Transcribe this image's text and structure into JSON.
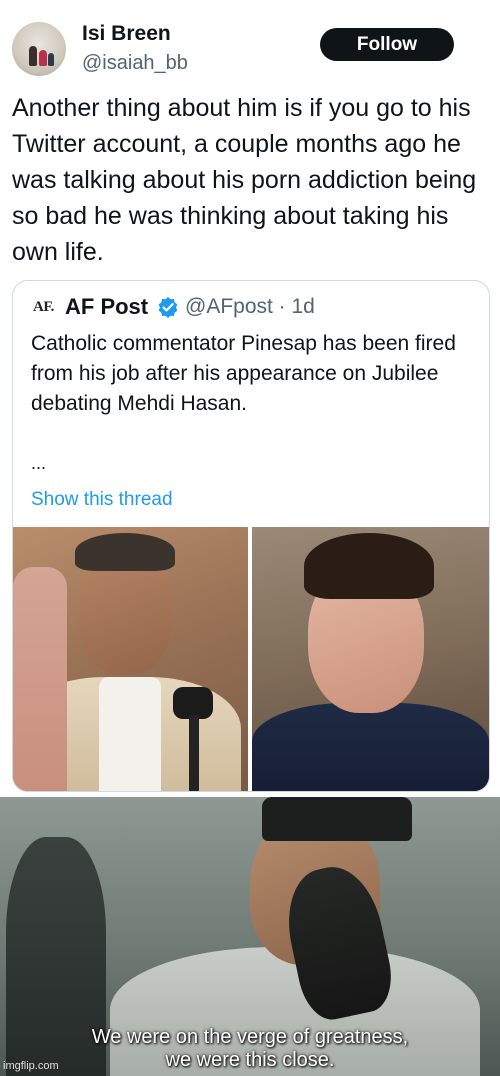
{
  "tweet": {
    "display_name": "Isi Breen",
    "handle": "@isaiah_bb",
    "follow_label": "Follow",
    "text": "Another thing about him is if you go to his Twitter account, a couple months ago he was talking about his porn addiction being so bad he was thinking about taking his own life."
  },
  "quote": {
    "logo_text": "AF.",
    "name": "AF Post",
    "meta": "@AFpost · 1d",
    "text": "Catholic commentator Pinesap has been fired from his job after his appearance on Jubilee debating Mehdi Hasan.",
    "ellipsis": "...",
    "show_thread": "Show this thread",
    "verified_color": "#1d9bf0",
    "link_color": "#1d9bf0"
  },
  "meme": {
    "caption_line1": "We were on the verge of greatness,",
    "caption_line2": "we were this close.",
    "watermark": "imgflip.com"
  }
}
